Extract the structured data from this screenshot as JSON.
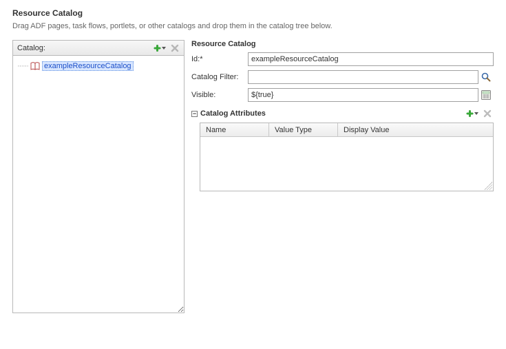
{
  "header": {
    "title": "Resource Catalog",
    "subtitle": "Drag ADF pages, task flows, portlets, or other catalogs and drop them in the catalog tree below."
  },
  "catalog_panel": {
    "label": "Catalog:"
  },
  "tree": {
    "root_label": "exampleResourceCatalog"
  },
  "details": {
    "section_title": "Resource Catalog",
    "id_label": "Id:*",
    "id_value": "exampleResourceCatalog",
    "filter_label": "Catalog Filter:",
    "filter_value": "",
    "visible_label": "Visible:",
    "visible_value": "${true}"
  },
  "attributes": {
    "title": "Catalog Attributes",
    "columns": {
      "name": "Name",
      "type": "Value Type",
      "value": "Display Value"
    }
  },
  "icons": {
    "add": "add-icon",
    "delete": "delete-icon",
    "search": "search-icon",
    "expression": "expression-icon",
    "collapse": "collapse-icon",
    "book": "book-icon"
  }
}
